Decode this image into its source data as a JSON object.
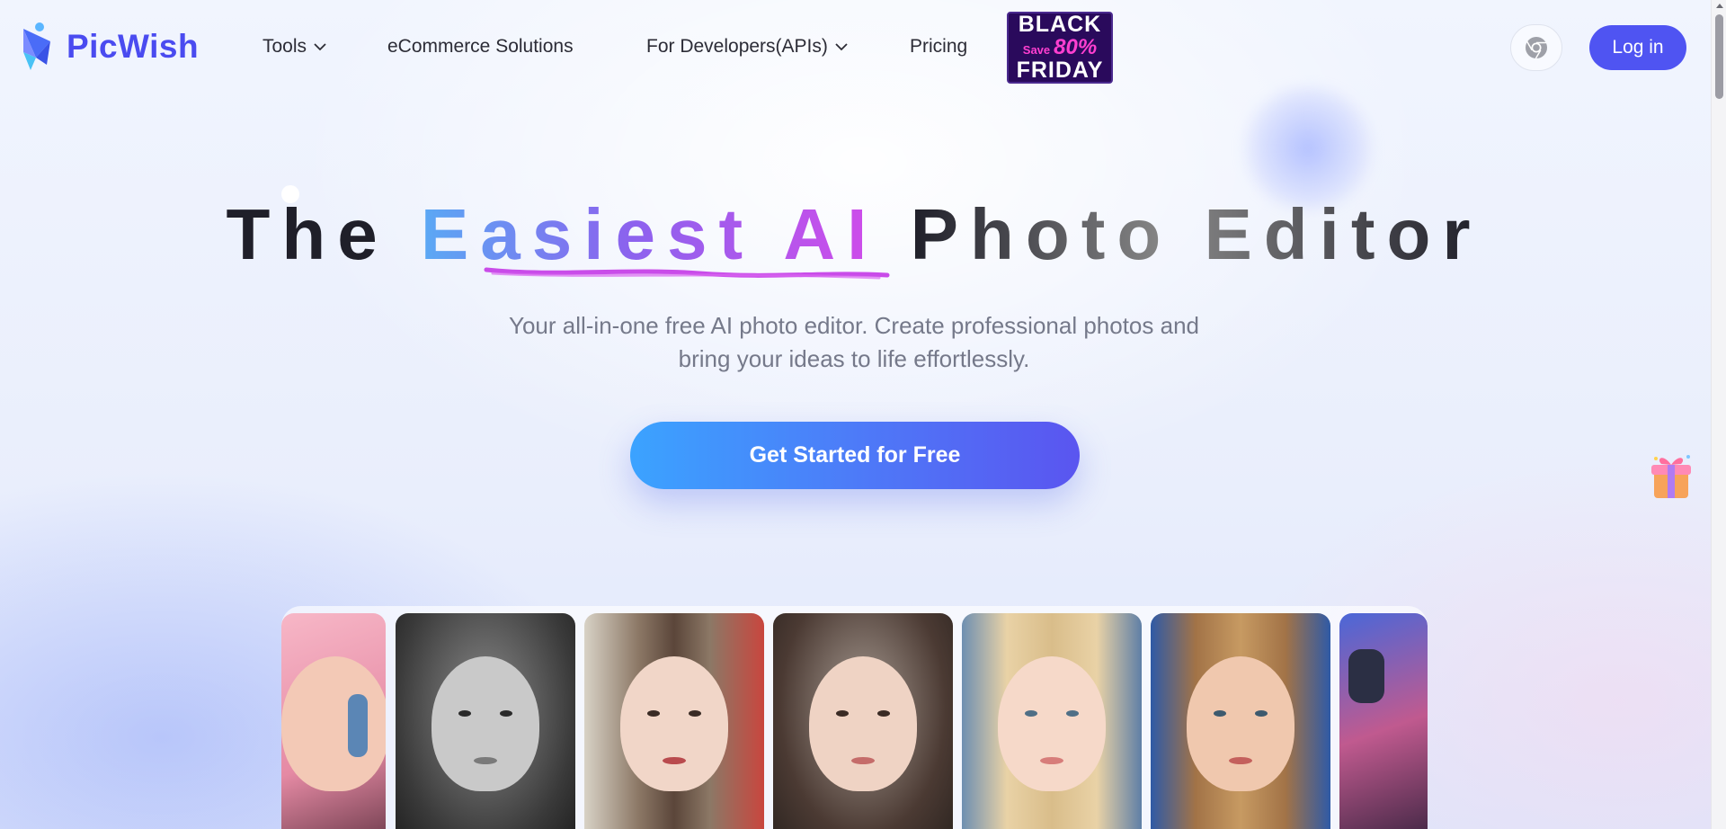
{
  "brand": {
    "name": "PicWish",
    "color": "#4a4bf0"
  },
  "nav": {
    "items": [
      {
        "label": "Tools",
        "dropdown": true
      },
      {
        "label": "eCommerce Solutions",
        "dropdown": false
      },
      {
        "label": "For Developers(APIs)",
        "dropdown": true
      },
      {
        "label": "Pricing",
        "dropdown": false
      }
    ],
    "promo": {
      "line1": "BLACK",
      "save": "Save",
      "percent": "80%",
      "line3": "FRIDAY"
    },
    "browser_icon": "chrome-icon",
    "login_label": "Log in"
  },
  "hero": {
    "title_part1": "The",
    "title_highlight": "Easiest AI",
    "title_part2": "Photo Editor",
    "subtitle_line1": "Your all-in-one free AI photo editor. Create professional photos and",
    "subtitle_line2": "bring your ideas to life effortlessly.",
    "cta_label": "Get Started for Free"
  },
  "side_widget": {
    "icon": "gift-icon"
  },
  "gallery": {
    "cards": [
      {
        "style": "pink-hair-headphones"
      },
      {
        "style": "black-and-white-portrait"
      },
      {
        "style": "monochrome-newspaper-collage"
      },
      {
        "style": "natural-portrait"
      },
      {
        "style": "blonde-braids-painted-background"
      },
      {
        "style": "starry-night-painting"
      },
      {
        "style": "neon-headphones"
      }
    ]
  },
  "colors": {
    "accent": "#4f54f2",
    "cta_start": "#3ba3ff",
    "cta_end": "#5a55f0",
    "highlight_end": "#d04cea"
  }
}
